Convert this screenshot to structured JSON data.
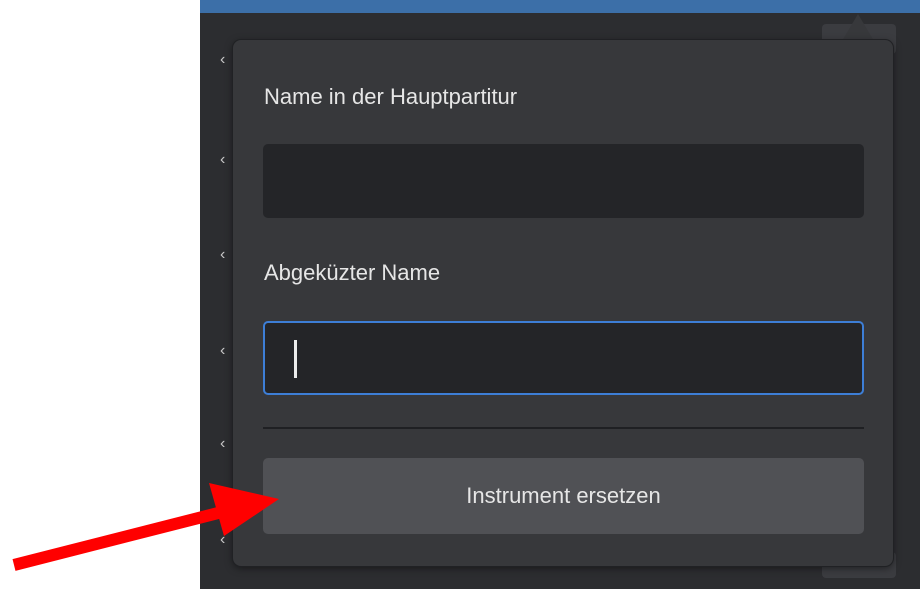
{
  "dialog": {
    "main_name_label": "Name in der Hauptpartitur",
    "main_name_value": "",
    "short_name_label": "Abgeküzter Name",
    "short_name_value": "",
    "replace_button_label": "Instrument ersetzen"
  },
  "background": {
    "chevron_glyph": "‹"
  },
  "annotation": {
    "arrow_color": "#ff0000",
    "arrow_target": "replace-instrument-button"
  },
  "colors": {
    "panel": "#37383b",
    "field": "#242528",
    "focus": "#3d7ed6",
    "button": "#505155",
    "accent_bar": "#3c6fa8"
  }
}
